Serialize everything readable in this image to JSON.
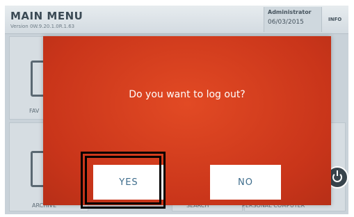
{
  "header": {
    "title": "MAIN MENU",
    "version": "Version 0W.9.20.1.0R.1.63",
    "user": "Administrator",
    "date": "06/03/2015",
    "info_label": "INFO"
  },
  "background_tiles": {
    "favorites_label": "FAV",
    "archive_label": "ARCHIVE",
    "search_label": "SEARCH",
    "personal_computer_label": "PERSONAL COMPUTER"
  },
  "dialog": {
    "question": "Do you want to log out?",
    "yes_label": "YES",
    "no_label": "NO",
    "background_color": "#d8401e",
    "button_text_color": "#3e6d8c"
  },
  "icons": [
    "power-icon",
    "document-icon"
  ]
}
